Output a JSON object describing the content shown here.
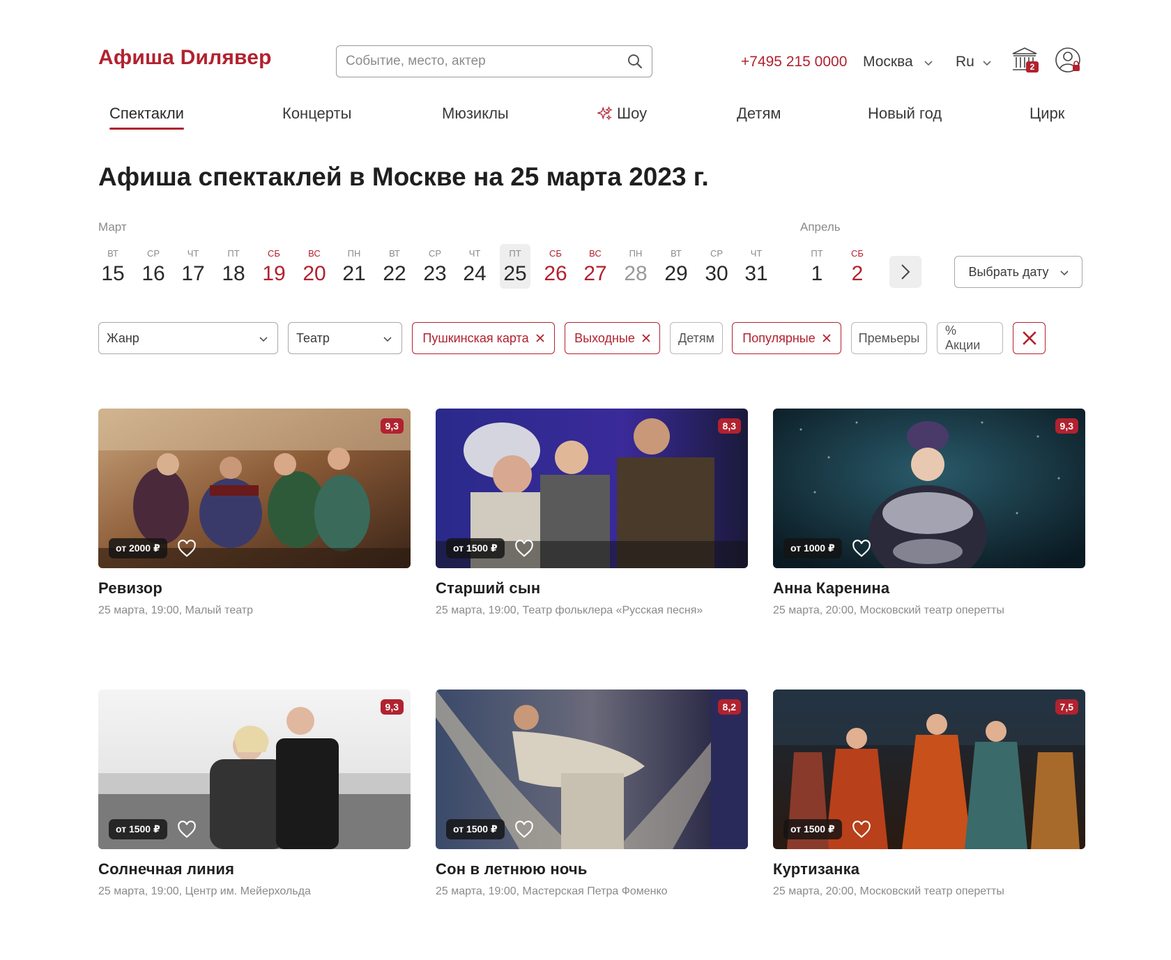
{
  "header": {
    "logo": "Афиша Dилявер",
    "search_placeholder": "Событие, место, актер",
    "phone": "+7495 215 0000",
    "city": "Москва",
    "language": "Ru",
    "cart_count": "2"
  },
  "nav": {
    "items": [
      {
        "label": "Спектакли",
        "active": true
      },
      {
        "label": "Концерты"
      },
      {
        "label": "Мюзиклы"
      },
      {
        "label": "Шоу",
        "icon": "sparkle-icon"
      },
      {
        "label": "Детям"
      },
      {
        "label": "Новый год"
      },
      {
        "label": "Цирк"
      }
    ]
  },
  "page_title": "Афиша спектаклей в Москве на 25 марта 2023 г.",
  "calendar": {
    "months": [
      "Март",
      "Апрель"
    ],
    "days": [
      {
        "dow": "ВТ",
        "num": "15"
      },
      {
        "dow": "СР",
        "num": "16"
      },
      {
        "dow": "ЧТ",
        "num": "17"
      },
      {
        "dow": "ПТ",
        "num": "18"
      },
      {
        "dow": "СБ",
        "num": "19",
        "weekend": true
      },
      {
        "dow": "ВС",
        "num": "20",
        "weekend": true
      },
      {
        "dow": "ПН",
        "num": "21"
      },
      {
        "dow": "ВТ",
        "num": "22"
      },
      {
        "dow": "СР",
        "num": "23"
      },
      {
        "dow": "ЧТ",
        "num": "24"
      },
      {
        "dow": "ПТ",
        "num": "25",
        "selected": true
      },
      {
        "dow": "СБ",
        "num": "26",
        "weekend": true
      },
      {
        "dow": "ВС",
        "num": "27",
        "weekend": true
      },
      {
        "dow": "ПН",
        "num": "28",
        "disabled": true
      },
      {
        "dow": "ВТ",
        "num": "29"
      },
      {
        "dow": "СР",
        "num": "30"
      },
      {
        "dow": "ЧТ",
        "num": "31"
      },
      {
        "dow": "ПТ",
        "num": "1"
      },
      {
        "dow": "СБ",
        "num": "2",
        "weekend": true
      }
    ],
    "pick_date_label": "Выбрать дату"
  },
  "filters": {
    "genre": "Жанр",
    "theatre": "Театр",
    "tags": [
      {
        "label": "Пушкинская карта",
        "active": true
      },
      {
        "label": "Выходные",
        "active": true
      },
      {
        "label": "Детям"
      },
      {
        "label": "Популярные",
        "active": true
      },
      {
        "label": "Премьеры"
      },
      {
        "label": "% Акции"
      }
    ]
  },
  "events": [
    {
      "title": "Ревизор",
      "meta": "25 марта, 19:00, Малый театр",
      "price": "от 2000 ₽",
      "rating": "9,3"
    },
    {
      "title": "Старший сын",
      "meta": "25 марта, 19:00, Театр фольклера «Русская песня»",
      "price": "от 1500 ₽",
      "rating": "8,3"
    },
    {
      "title": "Анна Каренина",
      "meta": "25 марта, 20:00, Московский театр оперетты",
      "price": "от 1000 ₽",
      "rating": "9,3"
    },
    {
      "title": "Солнечная линия",
      "meta": "25 марта, 19:00, Центр им. Мейерхольда",
      "price": "от 1500 ₽",
      "rating": "9,3"
    },
    {
      "title": "Сон в летнюю ночь",
      "meta": "25 марта, 19:00, Мастерская Петра Фоменко",
      "price": "от 1500 ₽",
      "rating": "8,2"
    },
    {
      "title": "Куртизанка",
      "meta": "25 марта, 20:00, Московский театр оперетты",
      "price": "от 1500 ₽",
      "rating": "7,5"
    }
  ],
  "colors": {
    "accent": "#b1222f",
    "text": "#2a2a2a",
    "muted": "#8a8a8a"
  }
}
